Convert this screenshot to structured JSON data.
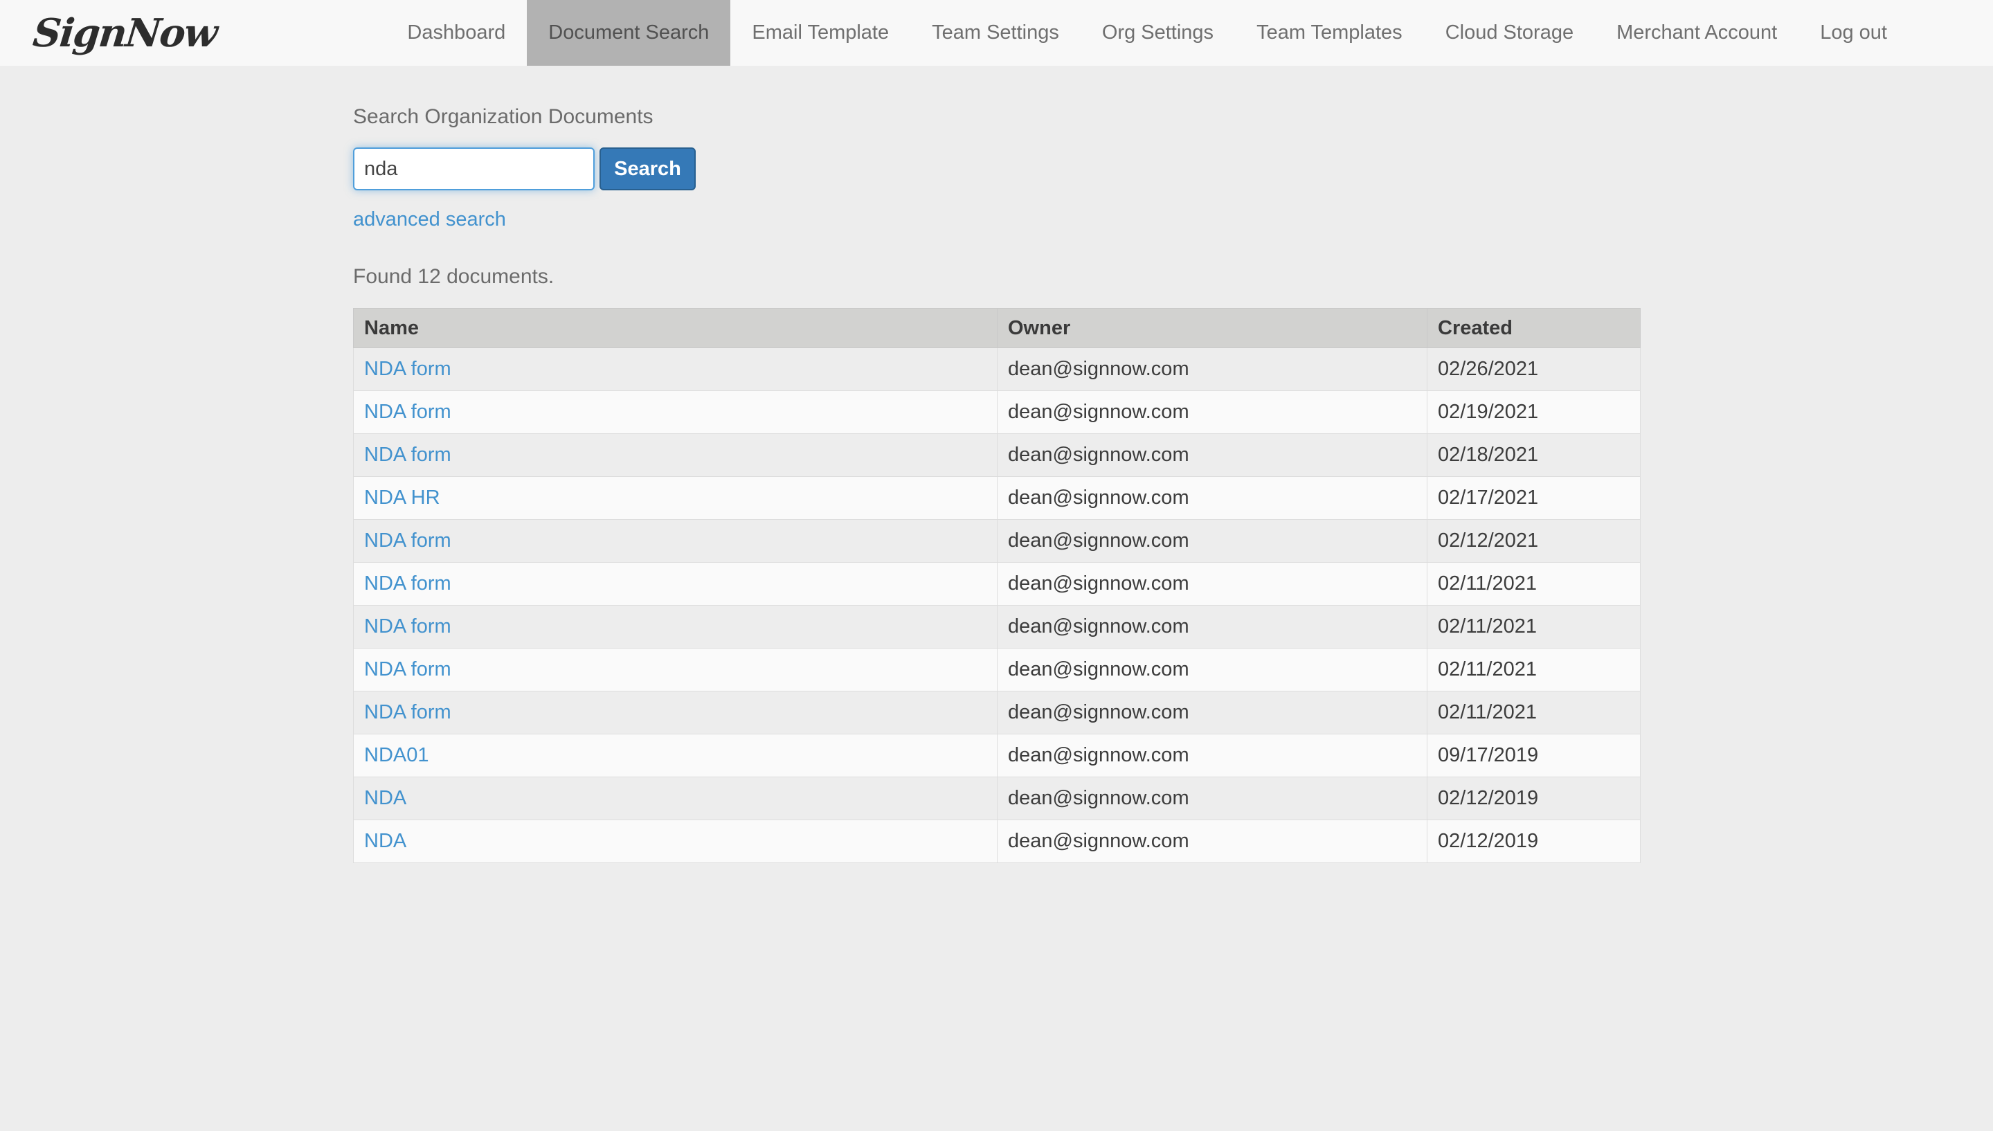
{
  "nav": {
    "logo": "SignNow",
    "items": [
      {
        "label": "Dashboard",
        "active": false
      },
      {
        "label": "Document Search",
        "active": true
      },
      {
        "label": "Email Template",
        "active": false
      },
      {
        "label": "Team Settings",
        "active": false
      },
      {
        "label": "Org Settings",
        "active": false
      },
      {
        "label": "Team Templates",
        "active": false
      },
      {
        "label": "Cloud Storage",
        "active": false
      },
      {
        "label": "Merchant Account",
        "active": false
      },
      {
        "label": "Log out",
        "active": false
      }
    ]
  },
  "search": {
    "label": "Search Organization Documents",
    "query": "nda",
    "button_label": "Search",
    "advanced_link_label": "advanced search",
    "results_summary": "Found 12 documents."
  },
  "table": {
    "columns": [
      "Name",
      "Owner",
      "Created"
    ],
    "rows": [
      {
        "name": "NDA form",
        "owner": "dean@signnow.com",
        "created": "02/26/2021"
      },
      {
        "name": "NDA form",
        "owner": "dean@signnow.com",
        "created": "02/19/2021"
      },
      {
        "name": "NDA form",
        "owner": "dean@signnow.com",
        "created": "02/18/2021"
      },
      {
        "name": "NDA HR",
        "owner": "dean@signnow.com",
        "created": "02/17/2021"
      },
      {
        "name": "NDA form",
        "owner": "dean@signnow.com",
        "created": "02/12/2021"
      },
      {
        "name": "NDA form",
        "owner": "dean@signnow.com",
        "created": "02/11/2021"
      },
      {
        "name": "NDA form",
        "owner": "dean@signnow.com",
        "created": "02/11/2021"
      },
      {
        "name": "NDA form",
        "owner": "dean@signnow.com",
        "created": "02/11/2021"
      },
      {
        "name": "NDA form",
        "owner": "dean@signnow.com",
        "created": "02/11/2021"
      },
      {
        "name": "NDA01",
        "owner": "dean@signnow.com",
        "created": "09/17/2019"
      },
      {
        "name": "NDA",
        "owner": "dean@signnow.com",
        "created": "02/12/2019"
      },
      {
        "name": "NDA",
        "owner": "dean@signnow.com",
        "created": "02/12/2019"
      }
    ]
  },
  "colors": {
    "page_background": "#ededed",
    "topbar_background": "#f8f8f8",
    "active_tab_background": "#b2b2b2",
    "button_blue": "#3579b7",
    "button_border_blue": "#286090",
    "link_blue": "#4292ce",
    "input_focus_border": "#4f9edb",
    "table_header_background": "#d2d2d0",
    "row_odd": "#fafafa",
    "row_even": "#ededed"
  }
}
